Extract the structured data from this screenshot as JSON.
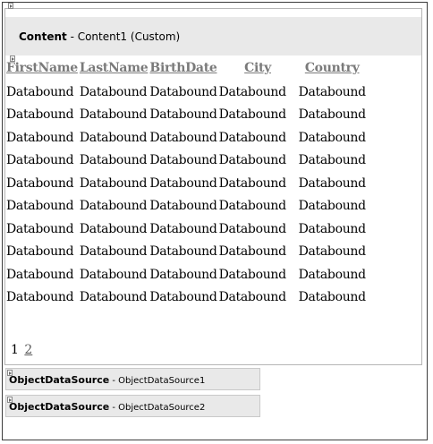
{
  "content": {
    "title": "Content",
    "subtitle": " - Content1 (Custom)"
  },
  "grid": {
    "columns": [
      "FirstName",
      "LastName",
      "BirthDate",
      "City",
      "Country"
    ],
    "cell_value": "Databound",
    "row_count": 10
  },
  "pager": {
    "current": "1",
    "next": "2"
  },
  "datasources": [
    {
      "title": "ObjectDataSource",
      "name": " - ObjectDataSource1"
    },
    {
      "title": "ObjectDataSource",
      "name": " - ObjectDataSource2"
    }
  ]
}
